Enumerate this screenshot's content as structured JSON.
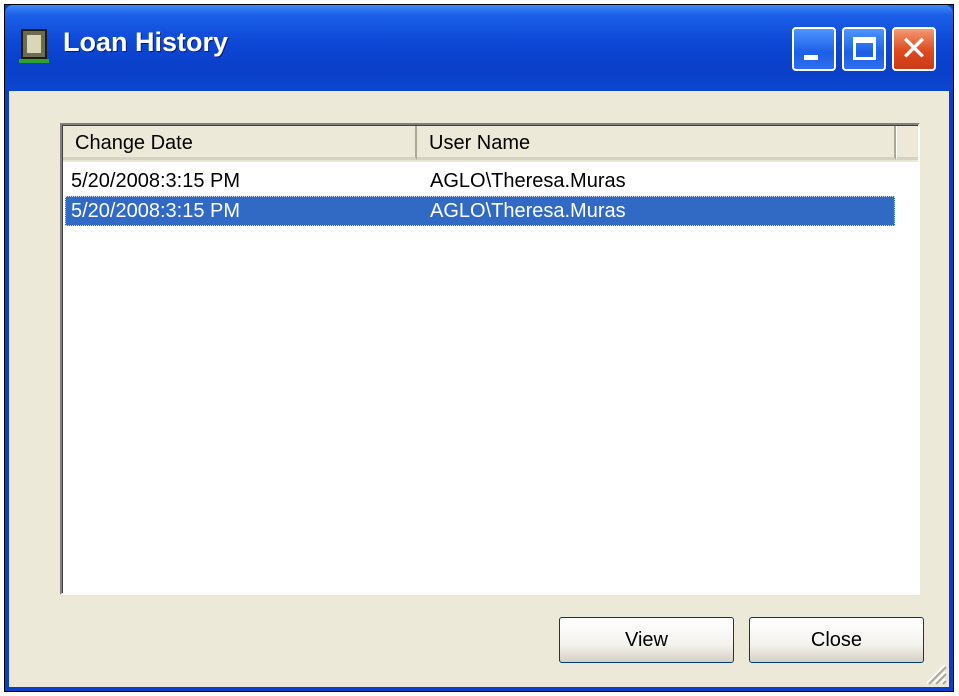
{
  "window": {
    "title": "Loan History"
  },
  "titlebar_buttons": {
    "minimize_icon": "minimize-icon",
    "maximize_icon": "maximize-icon",
    "close_icon": "close-icon",
    "close_glyph": "✕"
  },
  "list": {
    "columns": [
      "Change Date",
      "User Name"
    ],
    "rows": [
      {
        "change_date": "5/20/2008:3:15 PM",
        "user_name": "AGLO\\Theresa.Muras",
        "selected": false
      },
      {
        "change_date": "5/20/2008:3:15 PM",
        "user_name": "AGLO\\Theresa.Muras",
        "selected": true
      }
    ]
  },
  "buttons": {
    "view": "View",
    "close": "Close"
  },
  "colors": {
    "titlebar": "#0a3fc9",
    "selection": "#316ac5",
    "dialog_face": "#ece9d8"
  }
}
